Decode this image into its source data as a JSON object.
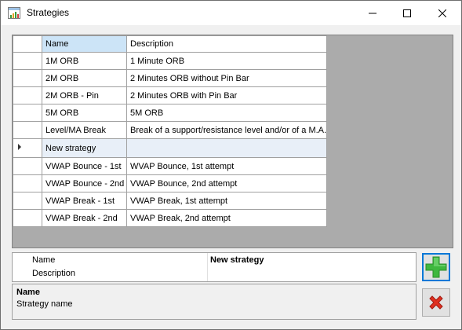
{
  "window": {
    "title": "Strategies"
  },
  "grid": {
    "columns": [
      "Name",
      "Description"
    ],
    "rows": [
      {
        "name": "1M ORB",
        "description": "1 Minute ORB"
      },
      {
        "name": "2M ORB",
        "description": "2 Minutes ORB without Pin Bar"
      },
      {
        "name": "2M ORB - Pin",
        "description": "2 Minutes ORB with Pin Bar"
      },
      {
        "name": "5M ORB",
        "description": "5M ORB"
      },
      {
        "name": "Level/MA Break",
        "description": "Break of a support/resistance level and/or of a M.A."
      },
      {
        "name": "New strategy",
        "description": ""
      },
      {
        "name": "VWAP Bounce - 1st",
        "description": "WVAP Bounce, 1st attempt"
      },
      {
        "name": "VWAP Bounce - 2nd",
        "description": "VWAP Bounce, 2nd attempt"
      },
      {
        "name": "VWAP Break - 1st",
        "description": "VWAP Break, 1st attempt"
      },
      {
        "name": "VWAP Break - 2nd",
        "description": "VWAP Break, 2nd attempt"
      }
    ],
    "current_row_index": 5
  },
  "properties": [
    {
      "label": "Name",
      "value": "New strategy"
    },
    {
      "label": "Description",
      "value": ""
    }
  ],
  "help": {
    "title": "Name",
    "description": "Strategy name"
  },
  "icons": {
    "add": "plus-icon",
    "delete": "x-icon",
    "current_row": "triangle-right-icon"
  },
  "colors": {
    "add_green": "#3fb83f",
    "delete_red": "#e03020",
    "selection_blue": "#cce4f7",
    "focus_blue": "#0078d7"
  }
}
